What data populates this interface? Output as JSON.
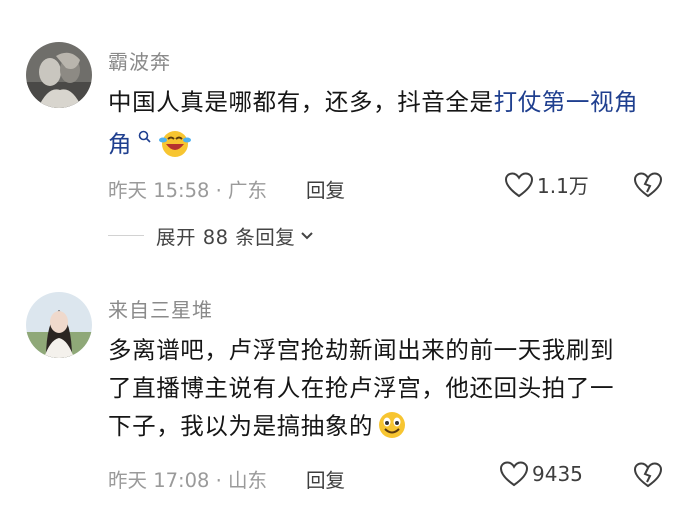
{
  "comments": [
    {
      "username": "霸波奔",
      "text_plain": "中国人真是哪都有，还多，抖音全是",
      "text_link": "打仗第一视角",
      "search_glyph": "ᵒ",
      "timestamp": "昨天 15:58 · 广东",
      "reply_label": "回复",
      "likes": "1.1万",
      "expand_label": "展开 88 条回复"
    },
    {
      "username": "来自三星堆",
      "line1": "多离谱吧，卢浮宫抢劫新闻出来的前一天我刷到",
      "line2": "了直播博主说有人在抢卢浮宫，他还回头拍了一",
      "line3": "下子，我以为是搞抽象的",
      "timestamp": "昨天 17:08 · 山东",
      "reply_label": "回复",
      "likes": "9435"
    }
  ],
  "colors": {
    "link": "#1f3f8f",
    "meta": "#9a9a9a",
    "text": "#161616"
  },
  "icons": [
    "heart-outline-icon",
    "broken-heart-icon",
    "chevron-down-icon",
    "search-icon",
    "laughing-crying-emoji",
    "grinning-emoji"
  ]
}
